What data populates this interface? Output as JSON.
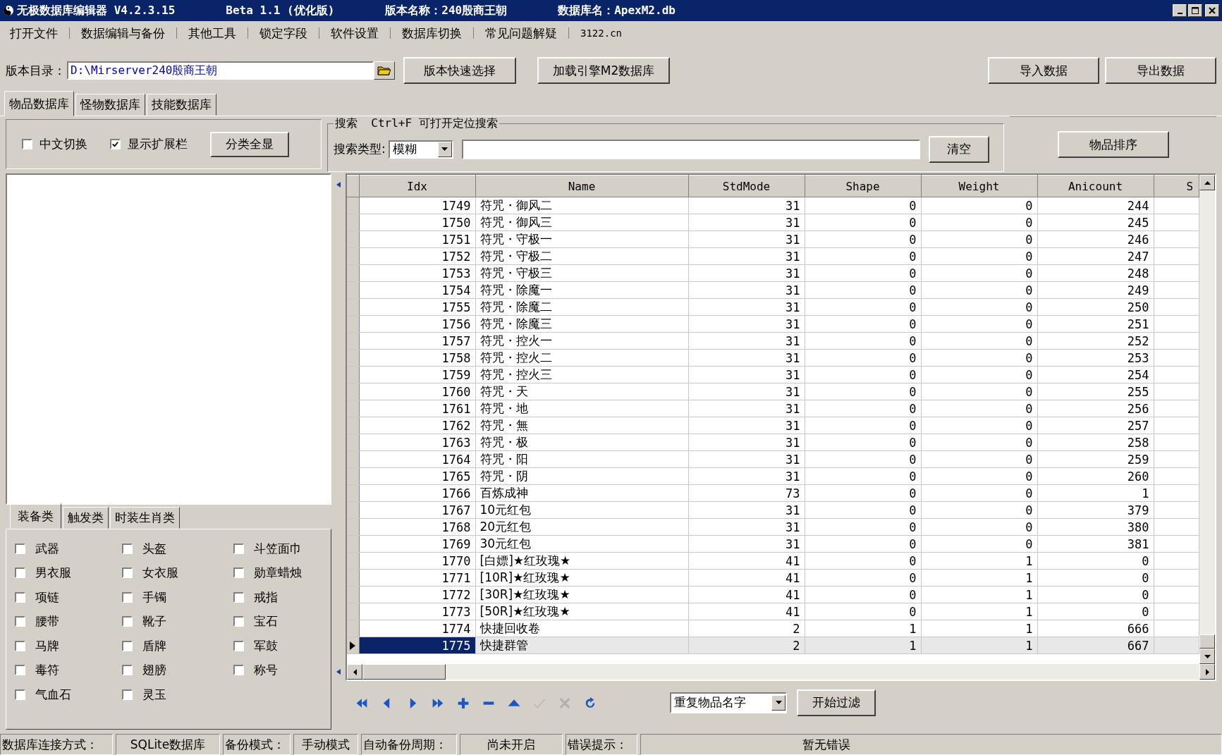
{
  "window": {
    "title_parts": [
      "无极数据库编辑器 V4.2.3.15",
      "Beta 1.1 (优化版)",
      "版本名称：240殷商王朝",
      "数据库名：ApexM2.db"
    ]
  },
  "menu": [
    "打开文件",
    "数据编辑与备份",
    "其他工具",
    "锁定字段",
    "软件设置",
    "数据库切换",
    "常见问题解疑",
    "3122.cn"
  ],
  "path_bar": {
    "label": "版本目录：",
    "value": "D:\\Mirserver240殷商王朝",
    "buttons": [
      "版本快速选择",
      "加载引擎M2数据库"
    ],
    "right_buttons": [
      "导入数据",
      "导出数据"
    ]
  },
  "tabs": [
    {
      "label": "物品数据库",
      "selected": true
    },
    {
      "label": "怪物数据库",
      "selected": false
    },
    {
      "label": "技能数据库",
      "selected": false
    }
  ],
  "options": {
    "checkboxes": [
      {
        "label": "中文切换",
        "checked": false
      },
      {
        "label": "显示扩展栏",
        "checked": true
      }
    ],
    "button": "分类全显"
  },
  "search": {
    "legend": "搜索  Ctrl+F 可打开定位搜索",
    "type_label": "搜索类型:",
    "type_value": "模糊",
    "clear_button": "清空"
  },
  "sort_button": "物品排序",
  "category_tabs": [
    {
      "label": "装备类",
      "selected": true
    },
    {
      "label": "触发类",
      "selected": false
    },
    {
      "label": "时装生肖类",
      "selected": false
    }
  ],
  "categories": [
    {
      "label": "武器",
      "checked": false
    },
    {
      "label": "头盔",
      "checked": false
    },
    {
      "label": "斗笠面巾",
      "checked": false
    },
    {
      "label": "男衣服",
      "checked": false
    },
    {
      "label": "女衣服",
      "checked": false
    },
    {
      "label": "勋章蜡烛",
      "checked": false
    },
    {
      "label": "项链",
      "checked": false
    },
    {
      "label": "手镯",
      "checked": false
    },
    {
      "label": "戒指",
      "checked": false
    },
    {
      "label": "腰带",
      "checked": false
    },
    {
      "label": "靴子",
      "checked": false
    },
    {
      "label": "宝石",
      "checked": false
    },
    {
      "label": "马牌",
      "checked": false
    },
    {
      "label": "盾牌",
      "checked": false
    },
    {
      "label": "军鼓",
      "checked": false
    },
    {
      "label": "毒符",
      "checked": false
    },
    {
      "label": "翅膀",
      "checked": false
    },
    {
      "label": "称号",
      "checked": false
    },
    {
      "label": "气血石",
      "checked": false
    },
    {
      "label": "灵玉",
      "checked": false
    }
  ],
  "table": {
    "columns": [
      "Idx",
      "Name",
      "StdMode",
      "Shape",
      "Weight",
      "Anicount",
      "S"
    ],
    "rows": [
      {
        "cells": [
          "1749",
          "符咒・御风二",
          "31",
          "0",
          "0",
          "244"
        ],
        "selected": false
      },
      {
        "cells": [
          "1750",
          "符咒・御风三",
          "31",
          "0",
          "0",
          "245"
        ],
        "selected": false
      },
      {
        "cells": [
          "1751",
          "符咒・守极一",
          "31",
          "0",
          "0",
          "246"
        ],
        "selected": false
      },
      {
        "cells": [
          "1752",
          "符咒・守极二",
          "31",
          "0",
          "0",
          "247"
        ],
        "selected": false
      },
      {
        "cells": [
          "1753",
          "符咒・守极三",
          "31",
          "0",
          "0",
          "248"
        ],
        "selected": false
      },
      {
        "cells": [
          "1754",
          "符咒・除魔一",
          "31",
          "0",
          "0",
          "249"
        ],
        "selected": false
      },
      {
        "cells": [
          "1755",
          "符咒・除魔二",
          "31",
          "0",
          "0",
          "250"
        ],
        "selected": false
      },
      {
        "cells": [
          "1756",
          "符咒・除魔三",
          "31",
          "0",
          "0",
          "251"
        ],
        "selected": false
      },
      {
        "cells": [
          "1757",
          "符咒・控火一",
          "31",
          "0",
          "0",
          "252"
        ],
        "selected": false
      },
      {
        "cells": [
          "1758",
          "符咒・控火二",
          "31",
          "0",
          "0",
          "253"
        ],
        "selected": false
      },
      {
        "cells": [
          "1759",
          "符咒・控火三",
          "31",
          "0",
          "0",
          "254"
        ],
        "selected": false
      },
      {
        "cells": [
          "1760",
          "符咒・天",
          "31",
          "0",
          "0",
          "255"
        ],
        "selected": false
      },
      {
        "cells": [
          "1761",
          "符咒・地",
          "31",
          "0",
          "0",
          "256"
        ],
        "selected": false
      },
      {
        "cells": [
          "1762",
          "符咒・無",
          "31",
          "0",
          "0",
          "257"
        ],
        "selected": false
      },
      {
        "cells": [
          "1763",
          "符咒・极",
          "31",
          "0",
          "0",
          "258"
        ],
        "selected": false
      },
      {
        "cells": [
          "1764",
          "符咒・阳",
          "31",
          "0",
          "0",
          "259"
        ],
        "selected": false
      },
      {
        "cells": [
          "1765",
          "符咒・阴",
          "31",
          "0",
          "0",
          "260"
        ],
        "selected": false
      },
      {
        "cells": [
          "1766",
          "百炼成神",
          "73",
          "0",
          "0",
          "1"
        ],
        "selected": false
      },
      {
        "cells": [
          "1767",
          "10元红包",
          "31",
          "0",
          "0",
          "379"
        ],
        "selected": false
      },
      {
        "cells": [
          "1768",
          "20元红包",
          "31",
          "0",
          "0",
          "380"
        ],
        "selected": false
      },
      {
        "cells": [
          "1769",
          "30元红包",
          "31",
          "0",
          "0",
          "381"
        ],
        "selected": false
      },
      {
        "cells": [
          "1770",
          "[白嫖]★红玫瑰★",
          "41",
          "0",
          "1",
          "0"
        ],
        "selected": false
      },
      {
        "cells": [
          "1771",
          "[10R]★红玫瑰★",
          "41",
          "0",
          "1",
          "0"
        ],
        "selected": false
      },
      {
        "cells": [
          "1772",
          "[30R]★红玫瑰★",
          "41",
          "0",
          "1",
          "0"
        ],
        "selected": false
      },
      {
        "cells": [
          "1773",
          "[50R]★红玫瑰★",
          "41",
          "0",
          "1",
          "0"
        ],
        "selected": false
      },
      {
        "cells": [
          "1774",
          "快捷回收卷",
          "2",
          "1",
          "1",
          "666"
        ],
        "selected": false
      },
      {
        "cells": [
          "1775",
          "快捷群管",
          "2",
          "1",
          "1",
          "667"
        ],
        "selected": true
      }
    ]
  },
  "navigator": [
    {
      "kind": "first",
      "disabled": false
    },
    {
      "kind": "prior",
      "disabled": false
    },
    {
      "kind": "next",
      "disabled": false
    },
    {
      "kind": "last",
      "disabled": false
    },
    {
      "kind": "insert",
      "disabled": false
    },
    {
      "kind": "delete",
      "disabled": false
    },
    {
      "kind": "edit",
      "disabled": false
    },
    {
      "kind": "post",
      "disabled": true
    },
    {
      "kind": "cancel",
      "disabled": true
    },
    {
      "kind": "refresh",
      "disabled": false
    }
  ],
  "filter": {
    "value": "重复物品名字",
    "button": "开始过滤"
  },
  "status_bar": [
    "数据库连接方式：",
    "SQLite数据库",
    "备份模式：",
    "手动模式",
    "自动备份周期：",
    "尚未开启",
    "错误提示：",
    "暂无错误"
  ]
}
